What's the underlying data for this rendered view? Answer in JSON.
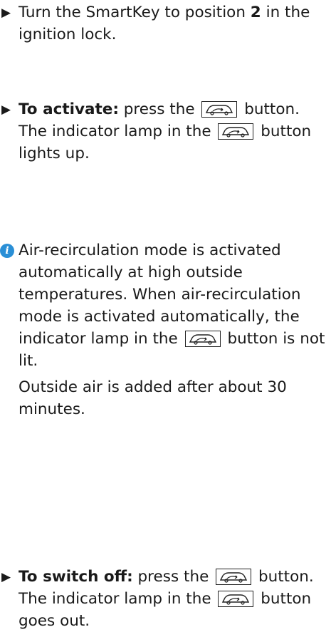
{
  "steps": {
    "turn_key": {
      "text_a": "Turn the SmartKey to position ",
      "bold_position": "2",
      "text_b": " in the ignition lock."
    },
    "activate": {
      "label": "To activate:",
      "text_a": " press the ",
      "text_b": " button.",
      "text_c": "The indicator lamp in the ",
      "text_d": " button lights up."
    },
    "switch_off": {
      "label": "To switch off:",
      "text_a": " press the ",
      "text_b": " button.",
      "text_c": "The indicator lamp in the ",
      "text_d": " button goes out."
    }
  },
  "note": {
    "icon": "info-icon",
    "para1_a": "Air-recirculation mode is activated automatically at high outside temperatures. When air-recirculation mode is activated automatically, the indicator lamp in the ",
    "para1_b": " button is not lit.",
    "para2": "Outside air is added after about 30 minutes."
  },
  "glyphs": {
    "arrow": "▶",
    "info": "i"
  }
}
